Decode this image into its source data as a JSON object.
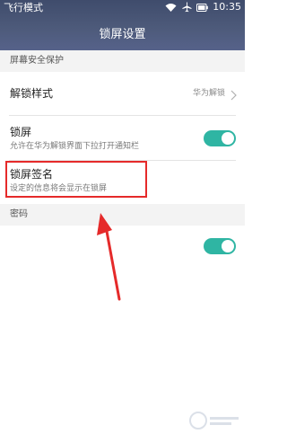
{
  "status_bar": {
    "left_text": "飞行模式",
    "time": "10:35",
    "icons": [
      "wifi-icon",
      "airplane-icon",
      "battery-icon"
    ]
  },
  "title_bar": {
    "title": "锁屏设置"
  },
  "sections": {
    "screen_security": {
      "header": "屏幕安全保护"
    },
    "password": {
      "header": "密码"
    }
  },
  "rows": {
    "unlock_style": {
      "title": "解锁样式",
      "value": "华为解锁"
    },
    "drag_notification": {
      "title": "锁屏",
      "subtitle": "允许在华为解锁界面下拉打开通知栏",
      "toggle_on": true
    },
    "lock_screen_signature": {
      "title": "锁屏签名",
      "subtitle": "设定的信息将会显示在锁屏"
    },
    "password_toggle": {
      "toggle_on": true
    }
  },
  "annotations": {
    "highlight_color": "#e52a2a",
    "arrow_color": "#e52a2a"
  },
  "theme": {
    "header_color": "#4d5a7a",
    "toggle_color": "#2fb5a3"
  }
}
